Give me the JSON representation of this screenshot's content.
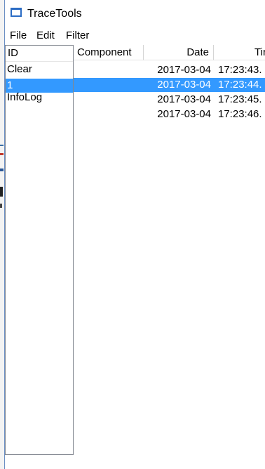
{
  "window": {
    "title": "TraceTools",
    "icon": "app-window-icon"
  },
  "menu": {
    "items": [
      "File",
      "Edit",
      "Filter"
    ]
  },
  "id_list": {
    "header": "ID",
    "items": [
      {
        "label": "Clear",
        "selected": false
      },
      {
        "label": "1",
        "selected": true
      },
      {
        "label": "InfoLog",
        "selected": false
      }
    ]
  },
  "grid": {
    "columns": [
      "Component",
      "Date",
      "Tir"
    ],
    "rows": [
      {
        "component": "",
        "date": "2017-03-04",
        "time": "17:23:43.",
        "selected": false
      },
      {
        "component": "",
        "date": "2017-03-04",
        "time": "17:23:44.",
        "selected": true
      },
      {
        "component": "",
        "date": "2017-03-04",
        "time": "17:23:45.",
        "selected": false
      },
      {
        "component": "",
        "date": "2017-03-04",
        "time": "17:23:46.",
        "selected": false
      }
    ]
  },
  "colors": {
    "selection": "#3399ff",
    "window_border": "#6b8fc4",
    "icon_accent": "#2b6cc4"
  }
}
